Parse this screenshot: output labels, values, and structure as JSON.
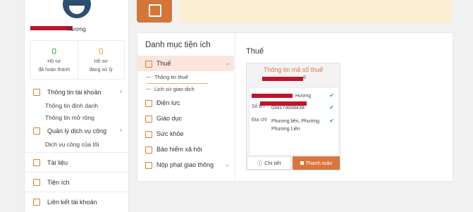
{
  "profile": {
    "name": "Hương",
    "stats": [
      {
        "value": "0",
        "label_1": "Hồ sơ",
        "label_2": "đã hoàn thành"
      },
      {
        "value": "0",
        "label_1": "Hồ sơ",
        "label_2": "đang xử lý"
      }
    ]
  },
  "sidebar": {
    "items": [
      {
        "label": "Thông tin tài khoản",
        "has_chevron": true
      },
      {
        "label": "Thông tin định danh"
      },
      {
        "label": "Thông tin mở rộng"
      },
      {
        "label": "Quản lý dịch vụ công",
        "has_chevron": true
      },
      {
        "label": "Dịch vụ công của tôi"
      },
      {
        "label": "Tài liệu"
      },
      {
        "label": "Tiện ích"
      },
      {
        "label": "Liên kết tài khoản"
      }
    ]
  },
  "panel": {
    "title": "Danh mục tiện ích",
    "categories": [
      {
        "label": "Thuế",
        "active": true
      },
      {
        "label": "Thông tin thuế",
        "sub": true,
        "active": true
      },
      {
        "label": "Lịch sử giao dịch",
        "sub": true
      },
      {
        "label": "Điện lực"
      },
      {
        "label": "Giáo dục"
      },
      {
        "label": "Sức khỏe"
      },
      {
        "label": "Bảo hiểm xã hội"
      },
      {
        "label": "Nộp phạt giao thông"
      }
    ]
  },
  "content": {
    "title": "Thuế",
    "card": {
      "heading": "Thông tin mã số thuế",
      "id_fragment": "6",
      "rows": [
        {
          "key": "",
          "value": "Hương"
        },
        {
          "key": "Số ĐT",
          "value": "034174008438"
        },
        {
          "key": "Địa chỉ",
          "value": "Phương liên, Phường Phương Liên"
        }
      ],
      "detail_button": "Chi tiết",
      "pay_button": "Thanh toán"
    }
  },
  "colors": {
    "accent": "#d9763e",
    "redaction": "#c0142a",
    "success": "#27a844"
  }
}
